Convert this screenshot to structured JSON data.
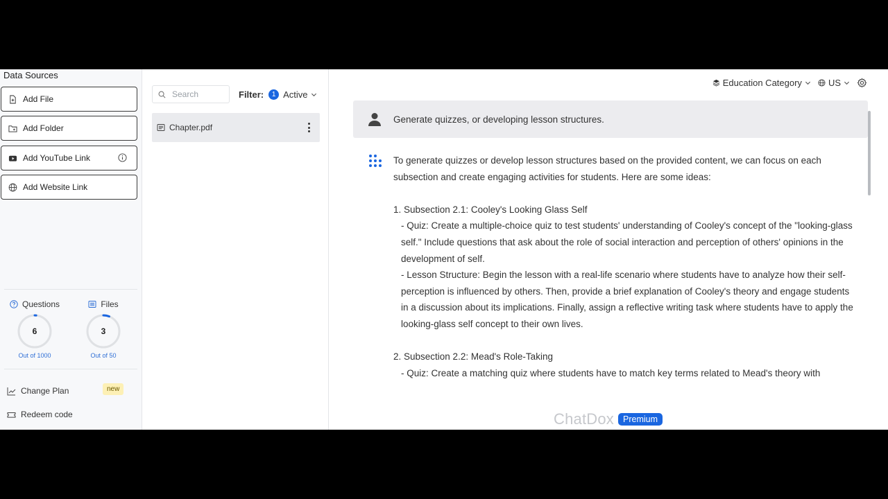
{
  "sidebar": {
    "title": "Data Sources",
    "buttons": [
      {
        "label": "Add File",
        "icon": "file-plus-icon"
      },
      {
        "label": "Add Folder",
        "icon": "folder-plus-icon"
      },
      {
        "label": "Add YouTube Link",
        "icon": "youtube-icon"
      },
      {
        "label": "Add Website Link",
        "icon": "globe-icon"
      }
    ],
    "stats": {
      "questions": {
        "label": "Questions",
        "value": "6",
        "limit": "Out of 1000",
        "fraction": 0.006
      },
      "files": {
        "label": "Files",
        "value": "3",
        "limit": "Out of 50",
        "fraction": 0.06
      }
    },
    "change_plan": "Change Plan",
    "new_badge": "new",
    "redeem": "Redeem code"
  },
  "files": {
    "search_placeholder": "Search",
    "filter_label": "Filter:",
    "filter_count": "1",
    "filter_value": "Active",
    "items": [
      {
        "name": "Chapter.pdf"
      }
    ]
  },
  "header": {
    "category": "Education Category",
    "region": "US"
  },
  "chat": {
    "user_message": "Generate quizzes, or developing lesson structures.",
    "reply": [
      "To generate quizzes or develop lesson structures based on the provided content, we can focus on each subsection and create engaging activities for students. Here are some ideas:",
      "",
      "1. Subsection 2.1: Cooley's Looking Glass Self",
      "- Quiz: Create a multiple-choice quiz to test students' understanding of Cooley's concept of the \"looking-glass self.\" Include questions that ask about the role of social interaction and perception of others' opinions in the development of self.",
      "- Lesson Structure: Begin the lesson with a real-life scenario where students have to analyze how their self-perception is influenced by others. Then, provide a brief explanation of Cooley's theory and engage students in a discussion about its implications. Finally, assign a reflective writing task where students have to apply the looking-glass self concept to their own lives.",
      "",
      "2. Subsection 2.2: Mead's Role-Taking",
      "- Quiz: Create a matching quiz where students have to match key terms related to Mead's theory with"
    ]
  },
  "brand": {
    "name": "ChatDox",
    "badge": "Premium"
  },
  "colors": {
    "accent": "#1a66e0",
    "progress_track": "#dfe1e4"
  }
}
